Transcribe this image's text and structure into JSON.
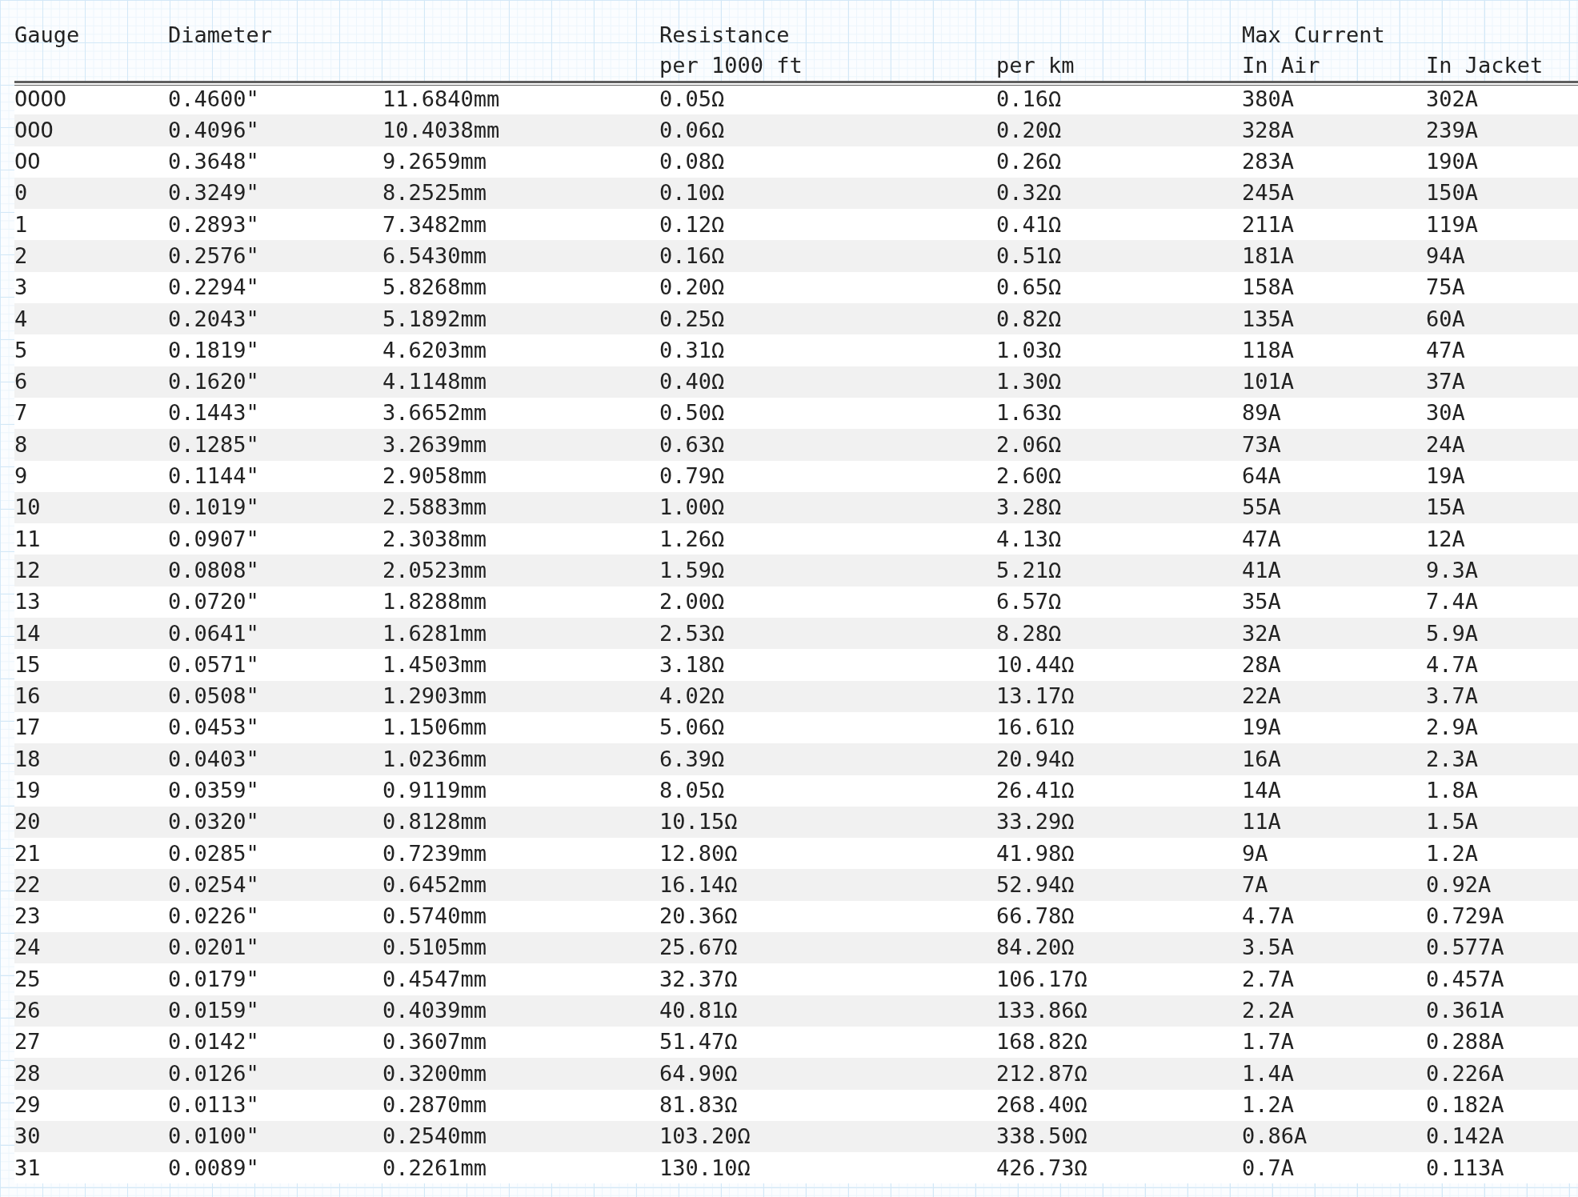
{
  "table": {
    "header_rows": [
      [
        "Gauge",
        "Diameter",
        "Resistance",
        "Max Current"
      ],
      [
        "per 1000 ft",
        "per km",
        "In Air",
        "In Jacket"
      ]
    ],
    "rows": [
      [
        "OOOO",
        "0.4600\"",
        "11.6840mm",
        "0.05Ω",
        "0.16Ω",
        "380A",
        "302A"
      ],
      [
        "OOO",
        "0.4096\"",
        "10.4038mm",
        "0.06Ω",
        "0.20Ω",
        "328A",
        "239A"
      ],
      [
        "OO",
        "0.3648\"",
        "9.2659mm",
        "0.08Ω",
        "0.26Ω",
        "283A",
        "190A"
      ],
      [
        "0",
        "0.3249\"",
        "8.2525mm",
        "0.10Ω",
        "0.32Ω",
        "245A",
        "150A"
      ],
      [
        "1",
        "0.2893\"",
        "7.3482mm",
        "0.12Ω",
        "0.41Ω",
        "211A",
        "119A"
      ],
      [
        "2",
        "0.2576\"",
        "6.5430mm",
        "0.16Ω",
        "0.51Ω",
        "181A",
        "94A"
      ],
      [
        "3",
        "0.2294\"",
        "5.8268mm",
        "0.20Ω",
        "0.65Ω",
        "158A",
        "75A"
      ],
      [
        "4",
        "0.2043\"",
        "5.1892mm",
        "0.25Ω",
        "0.82Ω",
        "135A",
        "60A"
      ],
      [
        "5",
        "0.1819\"",
        "4.6203mm",
        "0.31Ω",
        "1.03Ω",
        "118A",
        "47A"
      ],
      [
        "6",
        "0.1620\"",
        "4.1148mm",
        "0.40Ω",
        "1.30Ω",
        "101A",
        "37A"
      ],
      [
        "7",
        "0.1443\"",
        "3.6652mm",
        "0.50Ω",
        "1.63Ω",
        "89A",
        "30A"
      ],
      [
        "8",
        "0.1285\"",
        "3.2639mm",
        "0.63Ω",
        "2.06Ω",
        "73A",
        "24A"
      ],
      [
        "9",
        "0.1144\"",
        "2.9058mm",
        "0.79Ω",
        "2.60Ω",
        "64A",
        "19A"
      ],
      [
        "10",
        "0.1019\"",
        "2.5883mm",
        "1.00Ω",
        "3.28Ω",
        "55A",
        "15A"
      ],
      [
        "11",
        "0.0907\"",
        "2.3038mm",
        "1.26Ω",
        "4.13Ω",
        "47A",
        "12A"
      ],
      [
        "12",
        "0.0808\"",
        "2.0523mm",
        "1.59Ω",
        "5.21Ω",
        "41A",
        "9.3A"
      ],
      [
        "13",
        "0.0720\"",
        "1.8288mm",
        "2.00Ω",
        "6.57Ω",
        "35A",
        "7.4A"
      ],
      [
        "14",
        "0.0641\"",
        "1.6281mm",
        "2.53Ω",
        "8.28Ω",
        "32A",
        "5.9A"
      ],
      [
        "15",
        "0.0571\"",
        "1.4503mm",
        "3.18Ω",
        "10.44Ω",
        "28A",
        "4.7A"
      ],
      [
        "16",
        "0.0508\"",
        "1.2903mm",
        "4.02Ω",
        "13.17Ω",
        "22A",
        "3.7A"
      ],
      [
        "17",
        "0.0453\"",
        "1.1506mm",
        "5.06Ω",
        "16.61Ω",
        "19A",
        "2.9A"
      ],
      [
        "18",
        "0.0403\"",
        "1.0236mm",
        "6.39Ω",
        "20.94Ω",
        "16A",
        "2.3A"
      ],
      [
        "19",
        "0.0359\"",
        "0.9119mm",
        "8.05Ω",
        "26.41Ω",
        "14A",
        "1.8A"
      ],
      [
        "20",
        "0.0320\"",
        "0.8128mm",
        "10.15Ω",
        "33.29Ω",
        "11A",
        "1.5A"
      ],
      [
        "21",
        "0.0285\"",
        "0.7239mm",
        "12.80Ω",
        "41.98Ω",
        "9A",
        "1.2A"
      ],
      [
        "22",
        "0.0254\"",
        "0.6452mm",
        "16.14Ω",
        "52.94Ω",
        "7A",
        "0.92A"
      ],
      [
        "23",
        "0.0226\"",
        "0.5740mm",
        "20.36Ω",
        "66.78Ω",
        "4.7A",
        "0.729A"
      ],
      [
        "24",
        "0.0201\"",
        "0.5105mm",
        "25.67Ω",
        "84.20Ω",
        "3.5A",
        "0.577A"
      ],
      [
        "25",
        "0.0179\"",
        "0.4547mm",
        "32.37Ω",
        "106.17Ω",
        "2.7A",
        "0.457A"
      ],
      [
        "26",
        "0.0159\"",
        "0.4039mm",
        "40.81Ω",
        "133.86Ω",
        "2.2A",
        "0.361A"
      ],
      [
        "27",
        "0.0142\"",
        "0.3607mm",
        "51.47Ω",
        "168.82Ω",
        "1.7A",
        "0.288A"
      ],
      [
        "28",
        "0.0126\"",
        "0.3200mm",
        "64.90Ω",
        "212.87Ω",
        "1.4A",
        "0.226A"
      ],
      [
        "29",
        "0.0113\"",
        "0.2870mm",
        "81.83Ω",
        "268.40Ω",
        "1.2A",
        "0.182A"
      ],
      [
        "30",
        "0.0100\"",
        "0.2540mm",
        "103.20Ω",
        "338.50Ω",
        "0.86A",
        "0.142A"
      ],
      [
        "31",
        "0.0089\"",
        "0.2261mm",
        "130.10Ω",
        "426.73Ω",
        "0.7A",
        "0.113A"
      ]
    ]
  }
}
